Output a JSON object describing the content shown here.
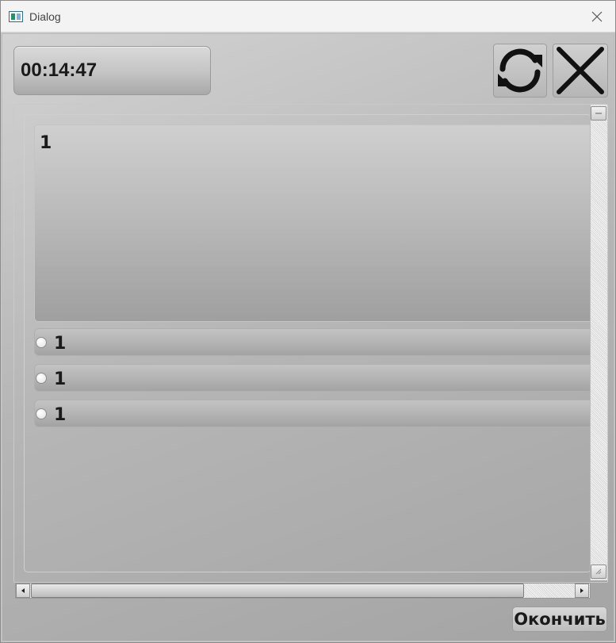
{
  "window": {
    "title": "Dialog"
  },
  "timer": {
    "value": "00:14:47"
  },
  "toolbar": {
    "refresh_icon": "refresh-icon",
    "exit_icon": "close-icon"
  },
  "question": {
    "text": "1"
  },
  "answers": [
    {
      "label": "1",
      "selected": false
    },
    {
      "label": "1",
      "selected": false
    },
    {
      "label": "1",
      "selected": false
    }
  ],
  "footer": {
    "finish_label": "Окончить"
  }
}
